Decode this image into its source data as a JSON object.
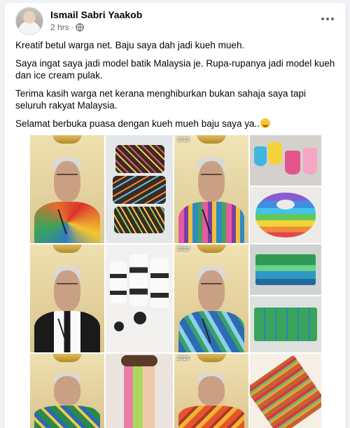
{
  "post": {
    "author": "Ismail Sabri Yaakob",
    "time": "2 hrs",
    "separator": "·",
    "paragraphs": [
      "Kreatif betul warga net. Baju saya dah jadi kueh mueh.",
      "Saya ingat saya jadi model batik Malaysia je. Rupa-rupanya jadi model kueh dan ice cream pulak.",
      "Terima kasih warga net kerana menghiburkan bukan sahaja saya tapi seluruh rakyat Malaysia.",
      "Selamat berbuka puasa dengan kueh mueh baju saya ya.."
    ]
  },
  "collage": {
    "year_labels": [
      "2020",
      "2020",
      "2020"
    ],
    "colors": {
      "backdrop": "#e9d9a6",
      "facebook_bg": "#f0f2f5",
      "meta_text": "#65676b"
    }
  },
  "icons": {
    "globe": "globe-icon",
    "more": "more-options-icon",
    "emoji": "grinning-face-emoji"
  }
}
